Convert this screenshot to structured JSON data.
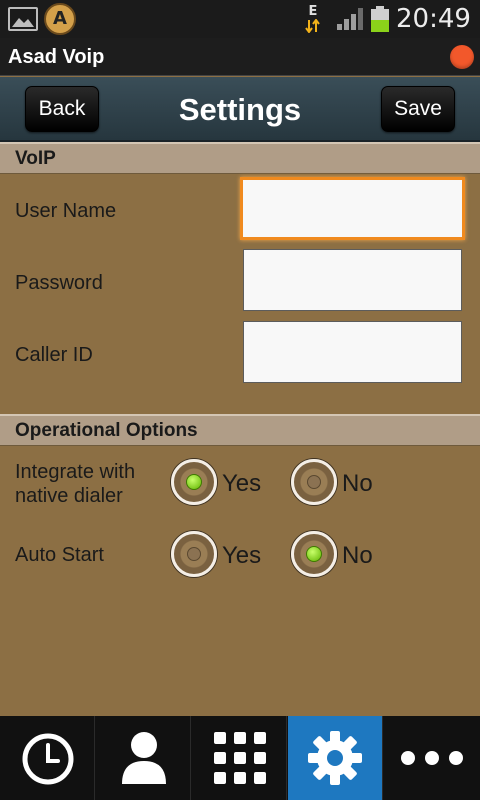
{
  "status_bar": {
    "network_type": "E",
    "time": "20:49"
  },
  "app": {
    "title": "Asad Voip"
  },
  "header": {
    "back_label": "Back",
    "title": "Settings",
    "save_label": "Save"
  },
  "voip": {
    "section_title": "VoIP",
    "fields": [
      {
        "label": "User Name",
        "value": ""
      },
      {
        "label": "Password",
        "value": ""
      },
      {
        "label": "Caller ID",
        "value": ""
      }
    ]
  },
  "options": {
    "section_title": "Operational Options",
    "integrate": {
      "label_line1": "Integrate with",
      "label_line2": "native dialer",
      "yes": "Yes",
      "no": "No",
      "selected": "Yes"
    },
    "auto_start": {
      "label": "Auto Start",
      "yes": "Yes",
      "no": "No",
      "selected": "No"
    }
  },
  "bottom_nav": {
    "items": [
      {
        "icon": "clock-icon"
      },
      {
        "icon": "contact-icon"
      },
      {
        "icon": "dialpad-icon"
      },
      {
        "icon": "gear-icon",
        "active": true
      },
      {
        "icon": "more-icon"
      }
    ]
  },
  "colors": {
    "accent_focus": "#f08a1e",
    "nav_active": "#1e78c0",
    "background": "#8c6f44"
  }
}
